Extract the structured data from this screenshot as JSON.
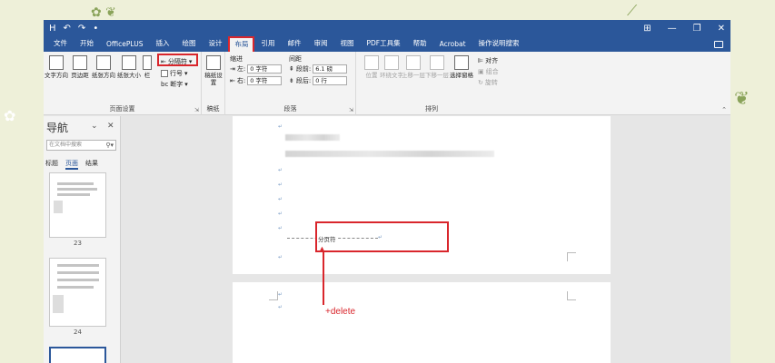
{
  "titlebar": {
    "qat": [
      "H",
      "↶",
      "↷",
      "•"
    ],
    "controls": [
      "⊞",
      "—",
      "❐",
      "✕"
    ]
  },
  "tabs": [
    "文件",
    "开始",
    "OfficePLUS",
    "插入",
    "绘图",
    "设计",
    "布局",
    "引用",
    "邮件",
    "审阅",
    "视图",
    "PDF工具集",
    "帮助",
    "Acrobat",
    "操作说明搜索"
  ],
  "active_tab": "布局",
  "ribbon": {
    "page_setup": {
      "buttons": [
        "文字方向",
        "页边距",
        "纸张方向",
        "纸张大小",
        "栏"
      ],
      "breaks": "分隔符",
      "line_numbers": "行号",
      "hyphenation": "断字",
      "label": "页面设置"
    },
    "draft": {
      "label": "稿纸设置",
      "group": "稿纸"
    },
    "paragraph": {
      "indent_header": "缩进",
      "spacing_header": "间距",
      "left_label": "左:",
      "left_value": "0 字符",
      "right_label": "右:",
      "right_value": "0 字符",
      "before_label": "段前:",
      "before_value": "6.1 磅",
      "after_label": "段后:",
      "after_value": "0 行",
      "label": "段落"
    },
    "arrange": {
      "buttons": [
        "位置",
        "环绕文字",
        "上移一层",
        "下移一层",
        "选择窗格"
      ],
      "align": "对齐",
      "group": "组合",
      "rotate": "旋转",
      "label": "排列"
    }
  },
  "nav": {
    "title": "导航",
    "search_placeholder": "在文档中搜索",
    "tabs": [
      "标题",
      "页面",
      "结果"
    ],
    "pages": [
      "23",
      "24"
    ]
  },
  "document": {
    "para_mark": "↵",
    "page_break_label": "分页符",
    "annotation": "+delete"
  },
  "colors": {
    "accent": "#2b579a",
    "annotation": "#d9262c"
  }
}
